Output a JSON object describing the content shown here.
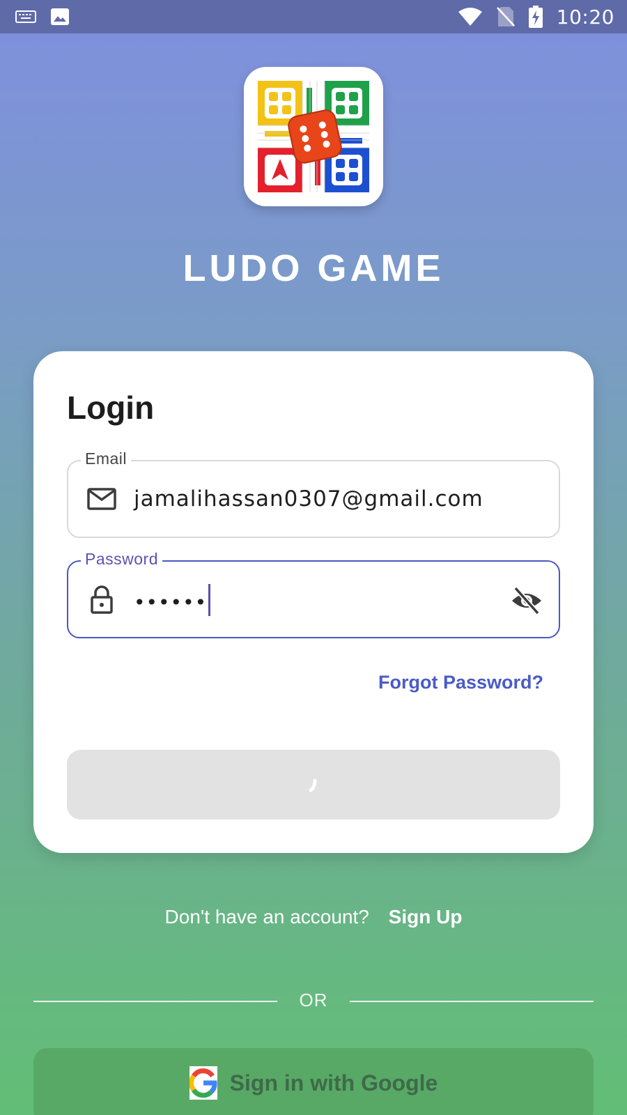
{
  "status_bar": {
    "time": "10:20",
    "icons": [
      "keyboard-icon",
      "image-icon",
      "wifi-icon",
      "no-sim-icon",
      "battery-charging-icon"
    ]
  },
  "app": {
    "title": "LUDO GAME",
    "logo_icon": "ludo-board-icon"
  },
  "login": {
    "heading": "Login",
    "email": {
      "label": "Email",
      "value": "jamalihassan0307@gmail.com",
      "icon": "mail-icon"
    },
    "password": {
      "label": "Password",
      "masked_value": "••••••",
      "icon": "lock-icon",
      "toggle_icon": "eye-off-icon"
    },
    "forgot_password": "Forgot Password?",
    "submit_state": "loading"
  },
  "signup": {
    "prompt": "Don't have an account?",
    "link": "Sign Up"
  },
  "divider": {
    "text": "OR"
  },
  "google": {
    "label": "Sign in with Google",
    "icon": "google-icon"
  },
  "colors": {
    "accent": "#4a57c2",
    "link": "#4a5bc6",
    "status_bar": "#5f6aa8",
    "google_button": "#58a965"
  }
}
